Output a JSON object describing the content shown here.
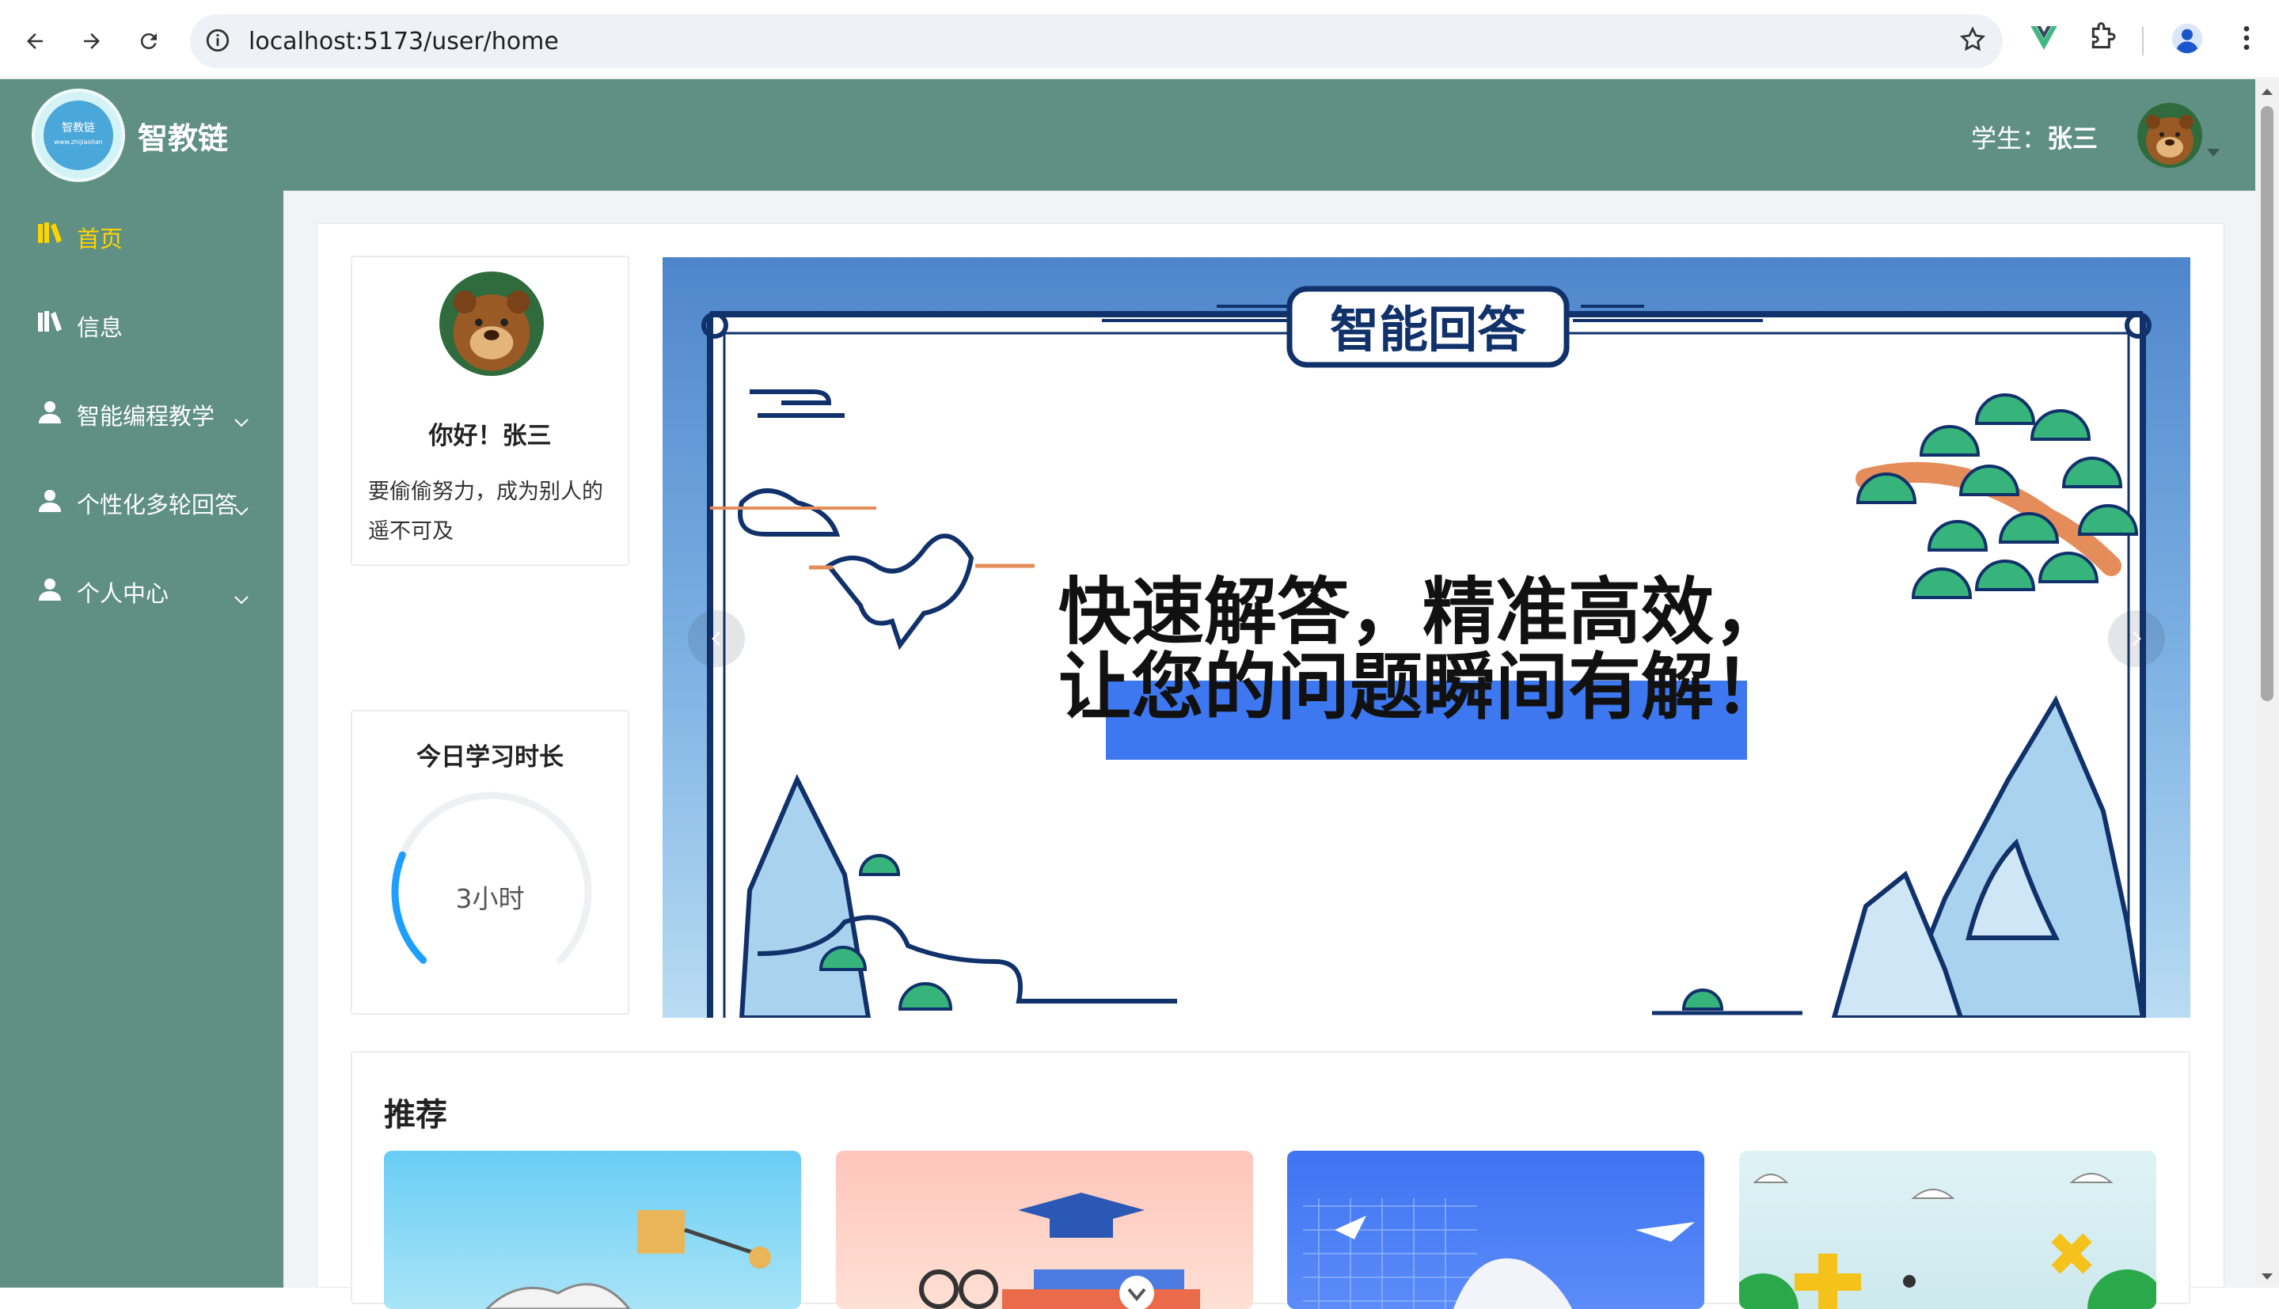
{
  "browser": {
    "url": "localhost:5173/user/home",
    "icons": [
      "back-arrow-icon",
      "forward-arrow-icon",
      "reload-icon",
      "site-info-icon",
      "bookmark-star-icon",
      "vue-devtools-icon",
      "extensions-icon",
      "profile-icon",
      "more-menu-icon"
    ]
  },
  "header": {
    "brand": "智教链",
    "logo_text_1": "智教链",
    "logo_text_2": "www.zhijiaolian",
    "role_label": "学生：",
    "user_name": "张三"
  },
  "sidebar": {
    "items": [
      {
        "label": "首页",
        "icon": "book-icon",
        "active": true,
        "expandable": false
      },
      {
        "label": "信息",
        "icon": "book-icon",
        "active": false,
        "expandable": false
      },
      {
        "label": "智能编程教学",
        "icon": "user-icon",
        "active": false,
        "expandable": true
      },
      {
        "label": "个性化多轮回答",
        "icon": "user-icon",
        "active": false,
        "expandable": true
      },
      {
        "label": "个人中心",
        "icon": "user-icon",
        "active": false,
        "expandable": true
      }
    ],
    "active_color": "#ffd400"
  },
  "profile": {
    "greeting": "你好！张三",
    "motto": "要偷偷努力，成为别人的遥不可及"
  },
  "study": {
    "title": "今日学习时长",
    "value": "3小时",
    "progress": 0.25
  },
  "carousel": {
    "banner_title": "智能回答",
    "headline_1": "快速解答，精准高效，",
    "headline_2": "让您的问题瞬间有解！"
  },
  "recommend": {
    "title": "推荐"
  },
  "colors": {
    "primary": "#5f9083",
    "accent": "#ffd400",
    "gauge": "#1e9fff"
  }
}
